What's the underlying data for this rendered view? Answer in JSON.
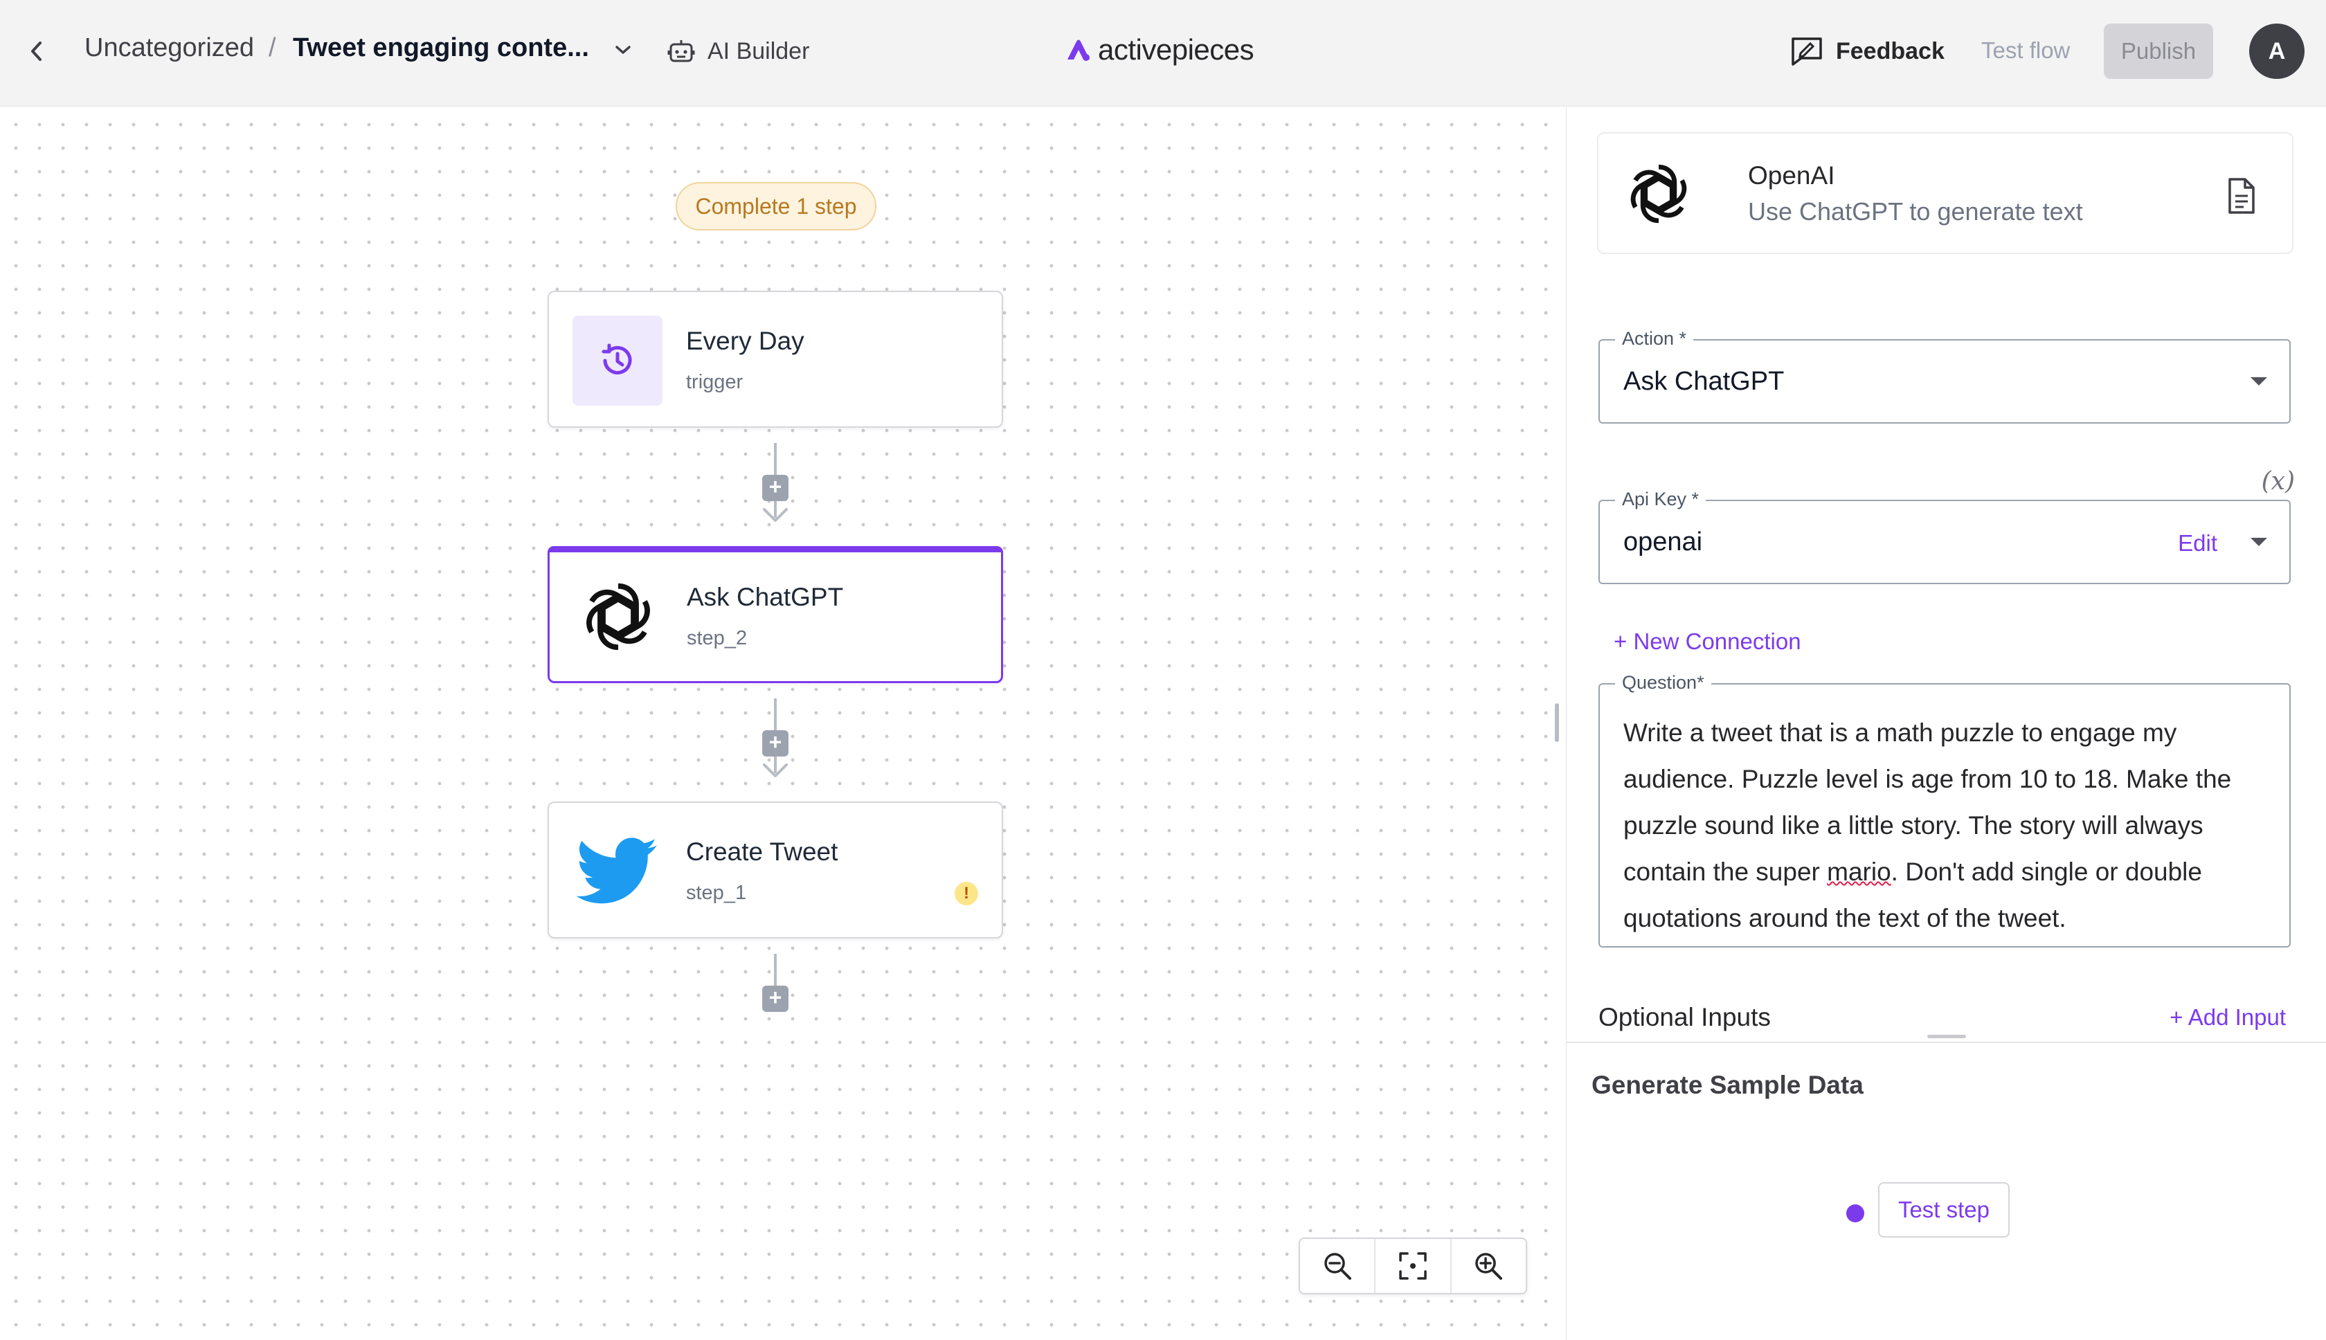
{
  "header": {
    "breadcrumb_folder": "Uncategorized",
    "breadcrumb_separator": "/",
    "flow_name": "Tweet engaging conte...",
    "ai_builder_label": "AI Builder",
    "brand": "activepieces",
    "feedback_label": "Feedback",
    "test_flow_label": "Test flow",
    "publish_label": "Publish",
    "avatar_initial": "A"
  },
  "canvas": {
    "status_pill": "Complete 1 step",
    "steps": [
      {
        "title": "Every Day",
        "subtitle": "trigger",
        "icon": "clock-icon"
      },
      {
        "title": "Ask ChatGPT",
        "subtitle": "step_2",
        "icon": "openai-icon",
        "selected": true
      },
      {
        "title": "Create Tweet",
        "subtitle": "step_1",
        "icon": "twitter-icon",
        "warning": "!"
      }
    ],
    "add_step_symbol": "+"
  },
  "panel": {
    "piece_name": "OpenAI",
    "piece_description": "Use ChatGPT to generate text",
    "action_label": "Action *",
    "action_value": "Ask ChatGPT",
    "variable_toggle": "(x)",
    "api_key_label": "Api Key *",
    "api_key_value": "openai",
    "edit_label": "Edit",
    "new_connection": "+ New Connection",
    "question_label": "Question*",
    "question_text_before": "Write a tweet that is a math puzzle to engage my audience. Puzzle level is age from 10 to 18. Make the puzzle sound like a little story. The story will always contain the super ",
    "question_text_misspelled": "mario",
    "question_text_after": ". Don't add single or double quotations around the text of the tweet.",
    "optional_inputs_label": "Optional Inputs",
    "add_input_label": "+ Add Input",
    "sample_data_title": "Generate Sample Data",
    "test_step_label": "Test step"
  },
  "colors": {
    "accent": "#7c3aed",
    "twitter_blue": "#1d9bf0",
    "warning": "#fde68a"
  }
}
